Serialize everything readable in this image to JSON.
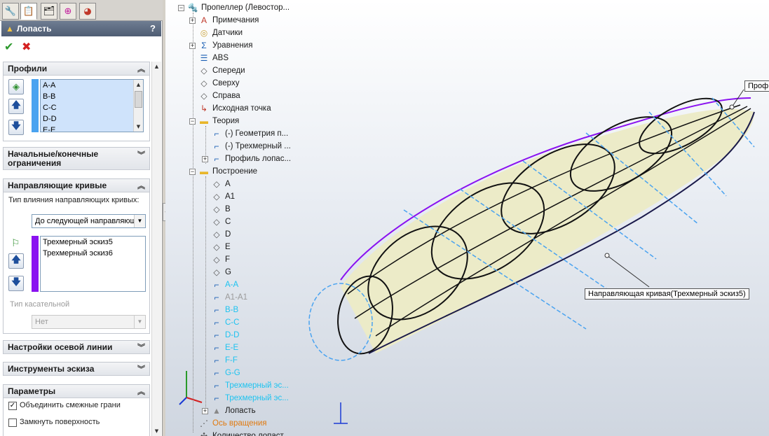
{
  "property_manager": {
    "tabs": [
      "feature-manager-icon",
      "property-manager-icon",
      "configuration-manager-icon",
      "dimxpert-icon",
      "display-manager-icon"
    ],
    "title": "Лопасть",
    "help": "?",
    "ok_symbol": "✔",
    "cancel_symbol": "✖",
    "profiles": {
      "header": "Профили",
      "items": [
        "A-A",
        "B-B",
        "C-C",
        "D-D",
        "E-E"
      ],
      "accent": "#4aa3f0"
    },
    "start_end": {
      "header": "Начальные/конечные ограничения"
    },
    "guide_curves": {
      "header": "Направляющие кривые",
      "influence_label": "Тип влияния направляющих кривых:",
      "influence_value": "До следующей направляющей",
      "items": [
        "Трехмерный эскиз5",
        "Трехмерный эскиз6"
      ],
      "accent": "#8a12f0",
      "tangent_label": "Тип касательной",
      "tangent_value": "Нет"
    },
    "centerline": {
      "header": "Настройки осевой линии"
    },
    "sketch_tools": {
      "header": "Инструменты эскиза"
    },
    "options": {
      "header": "Параметры",
      "merge_faces": "Объединить смежные грани",
      "merge_checked": true,
      "close_surface": "Замкнуть поверхность",
      "close_checked": false
    }
  },
  "tree": {
    "root": "Пропеллер  (Левостор...",
    "items": [
      {
        "label": "Примечания",
        "icon": "annotations-icon"
      },
      {
        "label": "Датчики",
        "icon": "sensors-icon"
      },
      {
        "label": "Уравнения",
        "icon": "equations-icon"
      },
      {
        "label": "ABS",
        "icon": "material-icon"
      },
      {
        "label": "Спереди",
        "icon": "plane-icon"
      },
      {
        "label": "Сверху",
        "icon": "plane-icon"
      },
      {
        "label": "Справа",
        "icon": "plane-icon"
      },
      {
        "label": "Исходная точка",
        "icon": "origin-icon"
      },
      {
        "label": "Теория",
        "icon": "folder-icon"
      },
      {
        "label": "(-) Геометрия п...",
        "icon": "sketch-3d-icon"
      },
      {
        "label": "(-) Трехмерный ...",
        "icon": "sketch-3d-icon"
      },
      {
        "label": "Профиль лопас...",
        "icon": "sketch-icon"
      },
      {
        "label": "Построение",
        "icon": "folder-icon"
      },
      {
        "label": "A",
        "icon": "plane-icon"
      },
      {
        "label": "A1",
        "icon": "plane-icon"
      },
      {
        "label": "B",
        "icon": "plane-icon"
      },
      {
        "label": "C",
        "icon": "plane-icon"
      },
      {
        "label": "D",
        "icon": "plane-icon"
      },
      {
        "label": "E",
        "icon": "plane-icon"
      },
      {
        "label": "F",
        "icon": "plane-icon"
      },
      {
        "label": "G",
        "icon": "plane-icon"
      },
      {
        "label": "A-A",
        "icon": "sketch-icon"
      },
      {
        "label": "A1-A1",
        "icon": "sketch-icon"
      },
      {
        "label": "B-B",
        "icon": "sketch-icon"
      },
      {
        "label": "C-C",
        "icon": "sketch-icon"
      },
      {
        "label": "D-D",
        "icon": "sketch-icon"
      },
      {
        "label": "E-E",
        "icon": "sketch-icon"
      },
      {
        "label": "F-F",
        "icon": "sketch-icon"
      },
      {
        "label": "G-G",
        "icon": "sketch-icon"
      },
      {
        "label": "Трехмерный эс...",
        "icon": "sketch-3d-icon"
      },
      {
        "label": "Трехмерный эс...",
        "icon": "sketch-3d-icon"
      },
      {
        "label": "Лопасть",
        "icon": "loft-icon"
      },
      {
        "label": "Ось вращения",
        "icon": "axis-icon"
      },
      {
        "label": "Количество лопаст...",
        "icon": "pattern-icon"
      }
    ]
  },
  "callouts": {
    "profile": "Профи",
    "guide": "Направляющая кривая(Трехмерный эскиз5)"
  }
}
